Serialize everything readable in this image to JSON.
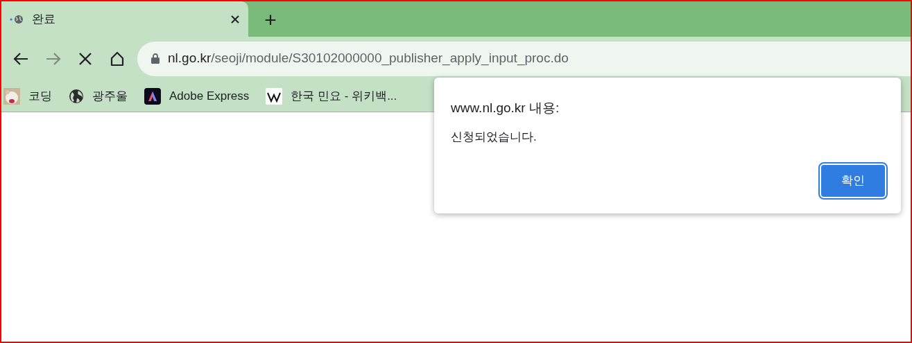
{
  "tabs": [
    {
      "title": "완료",
      "selected": true,
      "loading": true
    }
  ],
  "new_tab_button": "+",
  "address_bar": {
    "host": "nl.go.kr",
    "path": "/seoji/module/S30102000000_publisher_apply_input_proc.do"
  },
  "bookmarks": [
    {
      "label": "코딩"
    },
    {
      "kind": "globe",
      "label": "광주울"
    },
    {
      "kind": "adobe",
      "label": "Adobe Express"
    },
    {
      "kind": "wiki",
      "label": "한국 민요 - 위키백..."
    }
  ],
  "dialog": {
    "title": "www.nl.go.kr 내용:",
    "message": "신청되었습니다.",
    "button": "확인"
  }
}
